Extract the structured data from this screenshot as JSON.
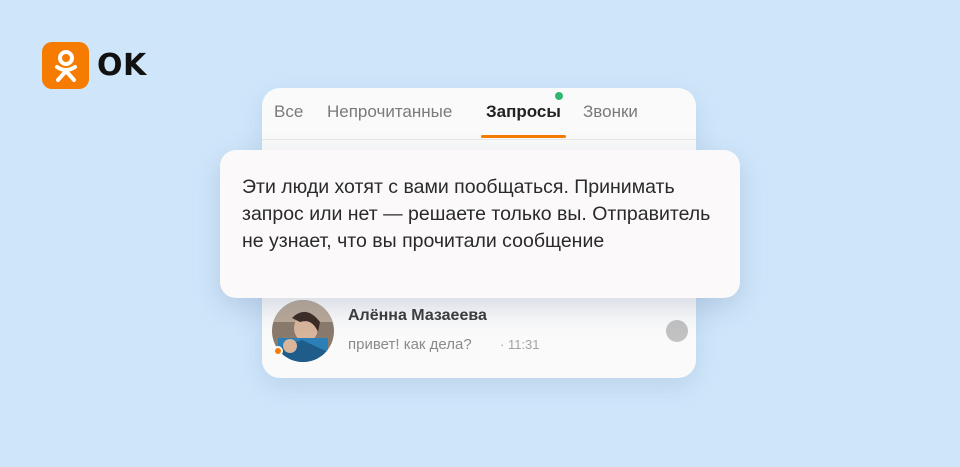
{
  "brand": {
    "name": "OK",
    "accent": "#f57c00"
  },
  "tabs": [
    {
      "label": "Все",
      "active": false
    },
    {
      "label": "Непрочитанные",
      "active": false
    },
    {
      "label": "Запросы",
      "active": true,
      "has_indicator": true
    },
    {
      "label": "Звонки",
      "active": false
    }
  ],
  "tooltip": {
    "text": "Эти люди хотят с вами пообщаться. Принимать запрос или нет — решаете только вы. Отправитель не узнает, что вы прочитали сообщение"
  },
  "conversation": {
    "name": "Алённа Мазаеева",
    "last_message": "привет! как дела?",
    "time": "· 11:31",
    "online": true
  },
  "colors": {
    "background": "#cfe6fa",
    "active_tab_underline": "#f57c00",
    "indicator_dot": "#2eb872"
  }
}
